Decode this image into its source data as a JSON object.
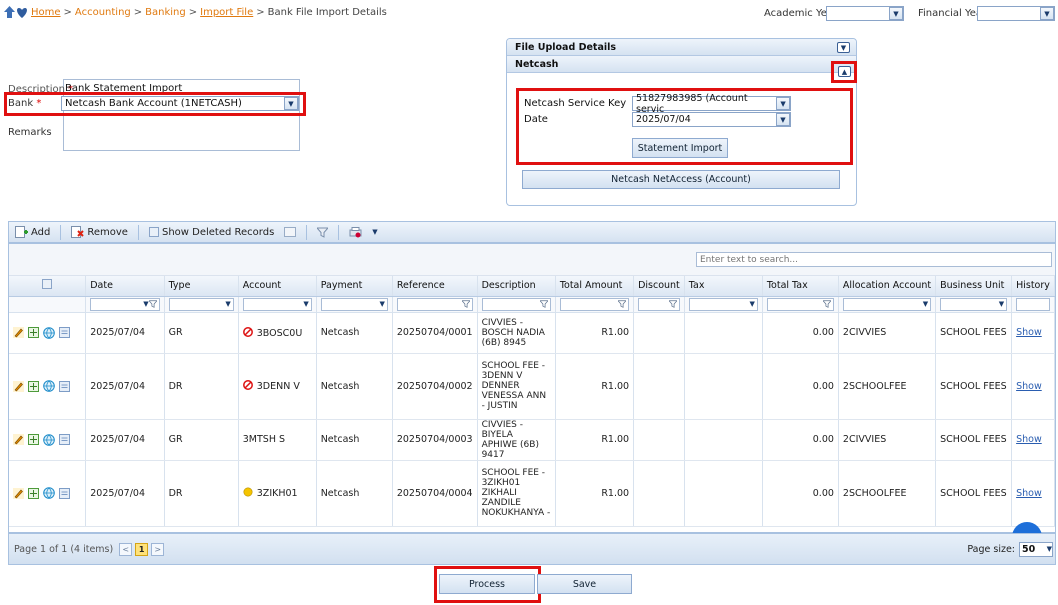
{
  "breadcrumb": {
    "home": "Home",
    "accounting": "Accounting",
    "banking": "Banking",
    "import_file": "Import File",
    "current": "Bank File Import Details",
    "sep": ">"
  },
  "top": {
    "academic_year_label": "Academic Year",
    "academic_year_value": "",
    "financial_year_label": "Financial Year",
    "financial_year_value": ""
  },
  "form": {
    "description_label": "Description",
    "description_value": "Bank Statement Import",
    "bank_label": "Bank",
    "bank_value": "Netcash Bank Account (1NETCASH)",
    "remarks_label": "Remarks",
    "required_mark": "*"
  },
  "upload": {
    "title": "File Upload Details",
    "netcash_title": "Netcash",
    "service_key_label": "Netcash Service Key",
    "service_key_value": "51827983985 (Account servic",
    "date_label": "Date",
    "date_value": "2025/07/04",
    "statement_import": "Statement Import",
    "netaccess": "Netcash NetAccess (Account)"
  },
  "toolbar": {
    "add": "Add",
    "remove": "Remove",
    "show_deleted": "Show Deleted Records"
  },
  "search": {
    "placeholder": "Enter text to search..."
  },
  "columns": [
    "Date",
    "Type",
    "Account",
    "Payment",
    "Reference",
    "Description",
    "Total Amount",
    "Discount",
    "Tax",
    "Total Tax",
    "Allocation Account",
    "Business Unit",
    "History"
  ],
  "rows": [
    {
      "date": "2025/07/04",
      "type": "GR",
      "account": "3BOSC0U",
      "status": "blocked",
      "payment": "Netcash",
      "reference": "20250704/0001",
      "description": "CIVVIES - BOSCH NADIA (6B) 8945",
      "total": "R1.00",
      "discount": "",
      "tax": "",
      "total_tax": "0.00",
      "allocation": "2CIVVIES",
      "unit": "SCHOOL FEES",
      "history": "Show"
    },
    {
      "date": "2025/07/04",
      "type": "DR",
      "account": "3DENN V",
      "status": "blocked",
      "payment": "Netcash",
      "reference": "20250704/0002",
      "description": "SCHOOL FEE - 3DENN V DENNER VENESSA ANN - JUSTIN",
      "total": "R1.00",
      "discount": "",
      "tax": "",
      "total_tax": "0.00",
      "allocation": "2SCHOOLFEE",
      "unit": "SCHOOL FEES",
      "history": "Show"
    },
    {
      "date": "2025/07/04",
      "type": "GR",
      "account": "3MTSH S",
      "status": "none",
      "payment": "Netcash",
      "reference": "20250704/0003",
      "description": "CIVVIES - BIYELA APHIWE (6B) 9417",
      "total": "R1.00",
      "discount": "",
      "tax": "",
      "total_tax": "0.00",
      "allocation": "2CIVVIES",
      "unit": "SCHOOL FEES",
      "history": "Show"
    },
    {
      "date": "2025/07/04",
      "type": "DR",
      "account": "3ZIKH01",
      "status": "warning",
      "payment": "Netcash",
      "reference": "20250704/0004",
      "description": "SCHOOL FEE - 3ZIKH01 ZIKHALI ZANDILE NOKUKHANYA -",
      "total": "R1.00",
      "discount": "",
      "tax": "",
      "total_tax": "0.00",
      "allocation": "2SCHOOLFEE",
      "unit": "SCHOOL FEES",
      "history": "Show"
    }
  ],
  "pager": {
    "info": "Page 1 of 1 (4 items)",
    "current_page": "1",
    "page_size_label": "Page size:",
    "page_size_value": "50"
  },
  "actions": {
    "process": "Process",
    "save": "Save"
  }
}
